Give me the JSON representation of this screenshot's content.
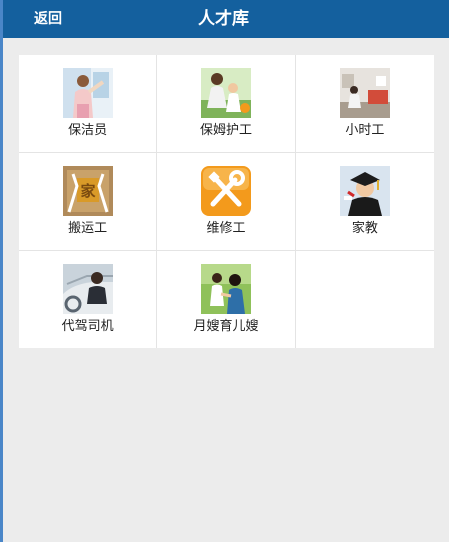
{
  "header": {
    "back_label": "返回",
    "title": "人才库",
    "background": "#14609e"
  },
  "categories": [
    {
      "label": "保洁员",
      "icon": "cleaner-photo-icon"
    },
    {
      "label": "保姆护工",
      "icon": "nanny-caregiver-photo-icon"
    },
    {
      "label": "小时工",
      "icon": "hourly-worker-photo-icon"
    },
    {
      "label": "搬运工",
      "icon": "movers-icon"
    },
    {
      "label": "维修工",
      "icon": "repair-tools-icon"
    },
    {
      "label": "家教",
      "icon": "tutor-graduate-photo-icon"
    },
    {
      "label": "代驾司机",
      "icon": "driver-photo-icon"
    },
    {
      "label": "月嫂育儿嫂",
      "icon": "maternity-nanny-photo-icon"
    }
  ],
  "colors": {
    "page_background": "#ececec",
    "grid_background": "#ffffff",
    "repair_icon_orange": "#f39a1c"
  }
}
